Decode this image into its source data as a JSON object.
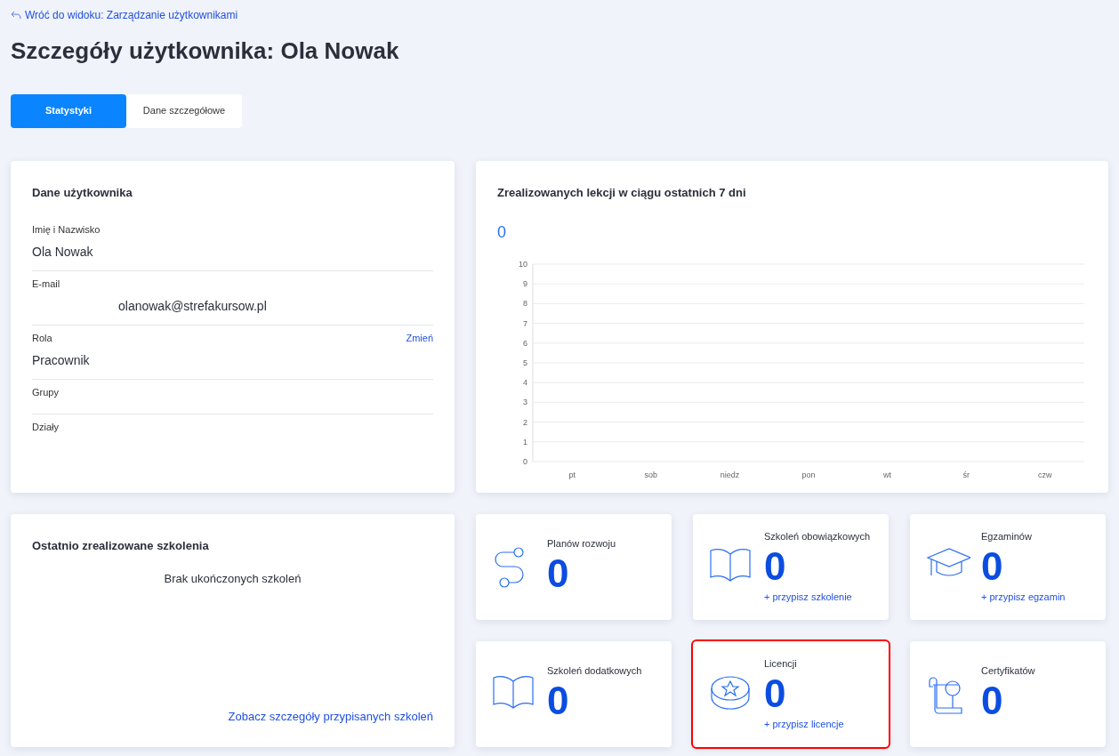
{
  "back_link": "Wróć do widoku: Zarządzanie użytkownikami",
  "title": "Szczegóły użytkownika: Ola Nowak",
  "tabs": [
    {
      "label": "Statystyki",
      "selected": true
    },
    {
      "label": "Dane szczegółowe",
      "selected": false
    }
  ],
  "user_card": {
    "title": "Dane użytkownika",
    "fields": [
      {
        "label": "Imię i Nazwisko",
        "value": "Ola Nowak",
        "indented": false
      },
      {
        "label": "E-mail",
        "value": "olanowak@strefakursow.pl",
        "indented": true
      },
      {
        "label": "Rola",
        "value": "Pracownik",
        "action": "Zmień",
        "indented": false
      },
      {
        "label": "Grupy"
      },
      {
        "label": "Działy"
      }
    ]
  },
  "lessons_card": {
    "title": "Zrealizowanych lekcji w ciągu ostatnich 7 dni",
    "total": "0",
    "chart_data": {
      "type": "bar",
      "categories": [
        "pt",
        "sob",
        "niedz",
        "pon",
        "wt",
        "śr",
        "czw"
      ],
      "values": [
        0,
        0,
        0,
        0,
        0,
        0,
        0
      ],
      "ylim": [
        0,
        10
      ],
      "grid": true,
      "yticks": [
        0,
        1,
        2,
        3,
        4,
        5,
        6,
        7,
        8,
        9,
        10
      ]
    }
  },
  "recent_card": {
    "title": "Ostatnio zrealizowane szkolenia",
    "empty_text": "Brak ukończonych szkoleń",
    "link": "Zobacz szczegóły przypisanych szkoleń"
  },
  "stats": [
    {
      "kind": "path",
      "label": "Planów rozwoju",
      "value": "0",
      "highlighted": false
    },
    {
      "kind": "book",
      "label": "Szkoleń obowiązkowych",
      "value": "0",
      "link": "+ przypisz szkolenie",
      "highlighted": false
    },
    {
      "kind": "cap",
      "label": "Egzaminów",
      "value": "0",
      "link": "+ przypisz egzamin",
      "highlighted": false
    },
    {
      "kind": "book",
      "label": "Szkoleń dodatkowych",
      "value": "0",
      "highlighted": false
    },
    {
      "kind": "coin",
      "label": "Licencji",
      "value": "0",
      "link": "+ przypisz licencje",
      "highlighted": true
    },
    {
      "kind": "scroll",
      "label": "Certyfikatów",
      "value": "0",
      "highlighted": false
    }
  ]
}
